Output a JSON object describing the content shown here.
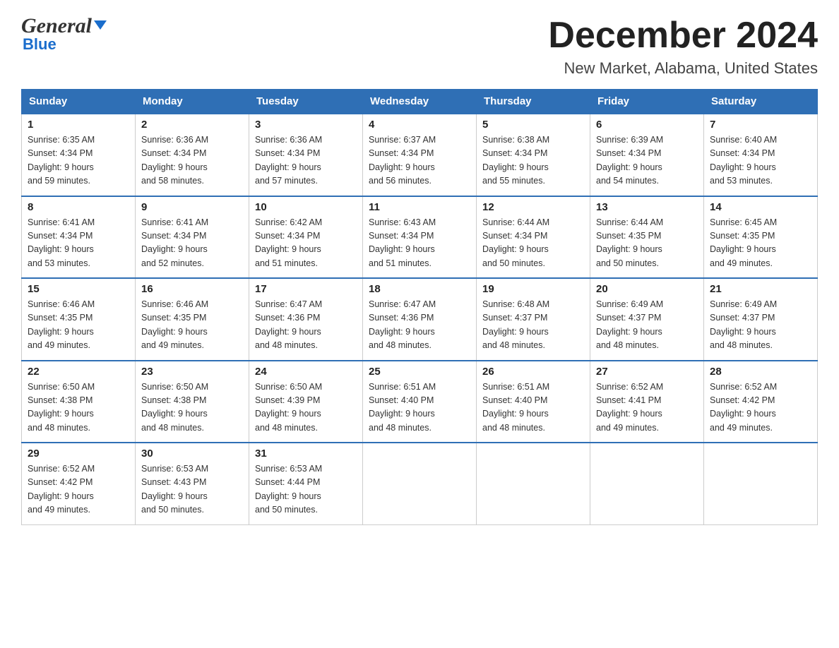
{
  "header": {
    "logo_text1": "General",
    "logo_text2": "Blue",
    "title": "December 2024",
    "subtitle": "New Market, Alabama, United States"
  },
  "weekdays": [
    "Sunday",
    "Monday",
    "Tuesday",
    "Wednesday",
    "Thursday",
    "Friday",
    "Saturday"
  ],
  "weeks": [
    [
      {
        "day": "1",
        "sunrise": "6:35 AM",
        "sunset": "4:34 PM",
        "daylight": "9 hours and 59 minutes."
      },
      {
        "day": "2",
        "sunrise": "6:36 AM",
        "sunset": "4:34 PM",
        "daylight": "9 hours and 58 minutes."
      },
      {
        "day": "3",
        "sunrise": "6:36 AM",
        "sunset": "4:34 PM",
        "daylight": "9 hours and 57 minutes."
      },
      {
        "day": "4",
        "sunrise": "6:37 AM",
        "sunset": "4:34 PM",
        "daylight": "9 hours and 56 minutes."
      },
      {
        "day": "5",
        "sunrise": "6:38 AM",
        "sunset": "4:34 PM",
        "daylight": "9 hours and 55 minutes."
      },
      {
        "day": "6",
        "sunrise": "6:39 AM",
        "sunset": "4:34 PM",
        "daylight": "9 hours and 54 minutes."
      },
      {
        "day": "7",
        "sunrise": "6:40 AM",
        "sunset": "4:34 PM",
        "daylight": "9 hours and 53 minutes."
      }
    ],
    [
      {
        "day": "8",
        "sunrise": "6:41 AM",
        "sunset": "4:34 PM",
        "daylight": "9 hours and 53 minutes."
      },
      {
        "day": "9",
        "sunrise": "6:41 AM",
        "sunset": "4:34 PM",
        "daylight": "9 hours and 52 minutes."
      },
      {
        "day": "10",
        "sunrise": "6:42 AM",
        "sunset": "4:34 PM",
        "daylight": "9 hours and 51 minutes."
      },
      {
        "day": "11",
        "sunrise": "6:43 AM",
        "sunset": "4:34 PM",
        "daylight": "9 hours and 51 minutes."
      },
      {
        "day": "12",
        "sunrise": "6:44 AM",
        "sunset": "4:34 PM",
        "daylight": "9 hours and 50 minutes."
      },
      {
        "day": "13",
        "sunrise": "6:44 AM",
        "sunset": "4:35 PM",
        "daylight": "9 hours and 50 minutes."
      },
      {
        "day": "14",
        "sunrise": "6:45 AM",
        "sunset": "4:35 PM",
        "daylight": "9 hours and 49 minutes."
      }
    ],
    [
      {
        "day": "15",
        "sunrise": "6:46 AM",
        "sunset": "4:35 PM",
        "daylight": "9 hours and 49 minutes."
      },
      {
        "day": "16",
        "sunrise": "6:46 AM",
        "sunset": "4:35 PM",
        "daylight": "9 hours and 49 minutes."
      },
      {
        "day": "17",
        "sunrise": "6:47 AM",
        "sunset": "4:36 PM",
        "daylight": "9 hours and 48 minutes."
      },
      {
        "day": "18",
        "sunrise": "6:47 AM",
        "sunset": "4:36 PM",
        "daylight": "9 hours and 48 minutes."
      },
      {
        "day": "19",
        "sunrise": "6:48 AM",
        "sunset": "4:37 PM",
        "daylight": "9 hours and 48 minutes."
      },
      {
        "day": "20",
        "sunrise": "6:49 AM",
        "sunset": "4:37 PM",
        "daylight": "9 hours and 48 minutes."
      },
      {
        "day": "21",
        "sunrise": "6:49 AM",
        "sunset": "4:37 PM",
        "daylight": "9 hours and 48 minutes."
      }
    ],
    [
      {
        "day": "22",
        "sunrise": "6:50 AM",
        "sunset": "4:38 PM",
        "daylight": "9 hours and 48 minutes."
      },
      {
        "day": "23",
        "sunrise": "6:50 AM",
        "sunset": "4:38 PM",
        "daylight": "9 hours and 48 minutes."
      },
      {
        "day": "24",
        "sunrise": "6:50 AM",
        "sunset": "4:39 PM",
        "daylight": "9 hours and 48 minutes."
      },
      {
        "day": "25",
        "sunrise": "6:51 AM",
        "sunset": "4:40 PM",
        "daylight": "9 hours and 48 minutes."
      },
      {
        "day": "26",
        "sunrise": "6:51 AM",
        "sunset": "4:40 PM",
        "daylight": "9 hours and 48 minutes."
      },
      {
        "day": "27",
        "sunrise": "6:52 AM",
        "sunset": "4:41 PM",
        "daylight": "9 hours and 49 minutes."
      },
      {
        "day": "28",
        "sunrise": "6:52 AM",
        "sunset": "4:42 PM",
        "daylight": "9 hours and 49 minutes."
      }
    ],
    [
      {
        "day": "29",
        "sunrise": "6:52 AM",
        "sunset": "4:42 PM",
        "daylight": "9 hours and 49 minutes."
      },
      {
        "day": "30",
        "sunrise": "6:53 AM",
        "sunset": "4:43 PM",
        "daylight": "9 hours and 50 minutes."
      },
      {
        "day": "31",
        "sunrise": "6:53 AM",
        "sunset": "4:44 PM",
        "daylight": "9 hours and 50 minutes."
      },
      null,
      null,
      null,
      null
    ]
  ],
  "labels": {
    "sunrise": "Sunrise:",
    "sunset": "Sunset:",
    "daylight": "Daylight:"
  }
}
